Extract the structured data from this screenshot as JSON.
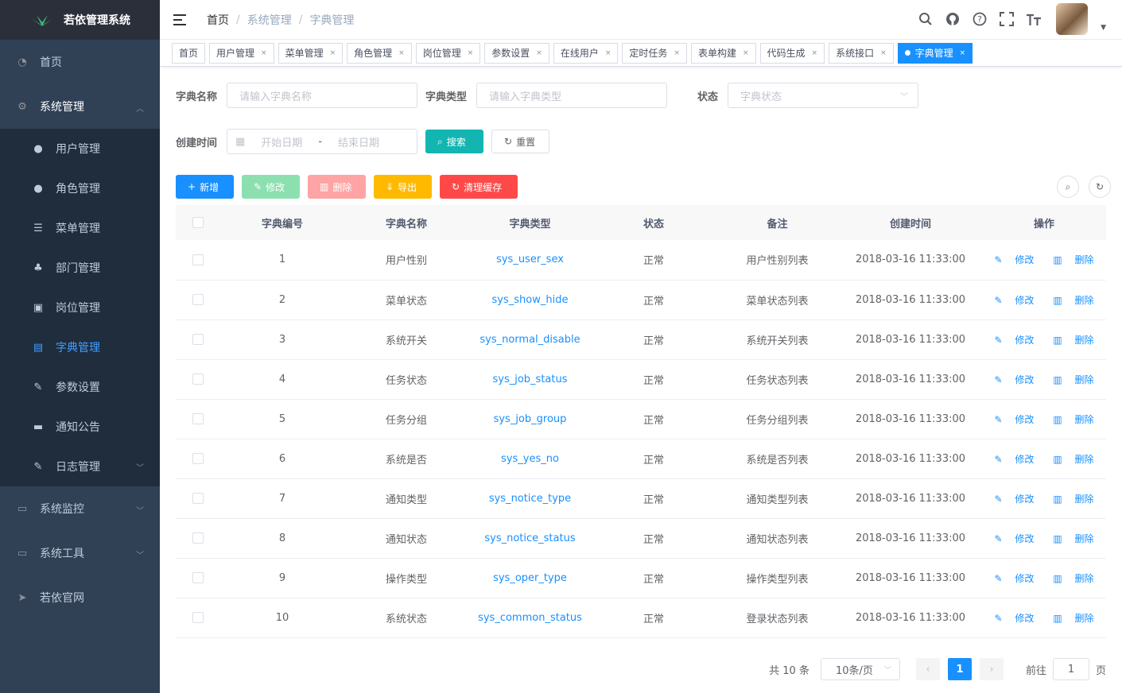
{
  "app": {
    "title": "若依管理系统"
  },
  "sidebar": {
    "home": "首页",
    "system": "系统管理",
    "sub": [
      "用户管理",
      "角色管理",
      "菜单管理",
      "部门管理",
      "岗位管理",
      "字典管理",
      "参数设置",
      "通知公告",
      "日志管理"
    ],
    "monitor": "系统监控",
    "tools": "系统工具",
    "site": "若依官网"
  },
  "breadcrumb": {
    "home": "首页",
    "sep": "/",
    "section": "系统管理",
    "page": "字典管理"
  },
  "tags": [
    "首页",
    "用户管理",
    "菜单管理",
    "角色管理",
    "岗位管理",
    "参数设置",
    "在线用户",
    "定时任务",
    "表单构建",
    "代码生成",
    "系统接口",
    "字典管理"
  ],
  "tag_close": "×",
  "search": {
    "name_label": "字典名称",
    "name_placeholder": "请输入字典名称",
    "type_label": "字典类型",
    "type_placeholder": "请输入字典类型",
    "status_label": "状态",
    "status_placeholder": "字典状态",
    "time_label": "创建时间",
    "start_placeholder": "开始日期",
    "range_sep": "-",
    "end_placeholder": "结束日期",
    "search_btn": "搜索",
    "reset_btn": "重置"
  },
  "toolbar": {
    "add": "新增",
    "edit": "修改",
    "delete": "删除",
    "export": "导出",
    "clear_cache": "清理缓存"
  },
  "table": {
    "headers": [
      "字典编号",
      "字典名称",
      "字典类型",
      "状态",
      "备注",
      "创建时间",
      "操作"
    ],
    "rows": [
      {
        "id": "1",
        "name": "用户性别",
        "type": "sys_user_sex",
        "status": "正常",
        "remark": "用户性别列表",
        "time": "2018-03-16 11:33:00"
      },
      {
        "id": "2",
        "name": "菜单状态",
        "type": "sys_show_hide",
        "status": "正常",
        "remark": "菜单状态列表",
        "time": "2018-03-16 11:33:00"
      },
      {
        "id": "3",
        "name": "系统开关",
        "type": "sys_normal_disable",
        "status": "正常",
        "remark": "系统开关列表",
        "time": "2018-03-16 11:33:00"
      },
      {
        "id": "4",
        "name": "任务状态",
        "type": "sys_job_status",
        "status": "正常",
        "remark": "任务状态列表",
        "time": "2018-03-16 11:33:00"
      },
      {
        "id": "5",
        "name": "任务分组",
        "type": "sys_job_group",
        "status": "正常",
        "remark": "任务分组列表",
        "time": "2018-03-16 11:33:00"
      },
      {
        "id": "6",
        "name": "系统是否",
        "type": "sys_yes_no",
        "status": "正常",
        "remark": "系统是否列表",
        "time": "2018-03-16 11:33:00"
      },
      {
        "id": "7",
        "name": "通知类型",
        "type": "sys_notice_type",
        "status": "正常",
        "remark": "通知类型列表",
        "time": "2018-03-16 11:33:00"
      },
      {
        "id": "8",
        "name": "通知状态",
        "type": "sys_notice_status",
        "status": "正常",
        "remark": "通知状态列表",
        "time": "2018-03-16 11:33:00"
      },
      {
        "id": "9",
        "name": "操作类型",
        "type": "sys_oper_type",
        "status": "正常",
        "remark": "操作类型列表",
        "time": "2018-03-16 11:33:00"
      },
      {
        "id": "10",
        "name": "系统状态",
        "type": "sys_common_status",
        "status": "正常",
        "remark": "登录状态列表",
        "time": "2018-03-16 11:33:00"
      }
    ],
    "row_edit": "修改",
    "row_delete": "删除"
  },
  "pagination": {
    "total": "共 10 条",
    "size": "10条/页",
    "current": "1",
    "goto": "前往",
    "goto_value": "1",
    "page_unit": "页"
  },
  "colors": {
    "sidebar": "#304156",
    "primary": "#1890ff",
    "success": "#13ce66",
    "danger": "#ff4949",
    "warning": "#ffba00",
    "cyan": "#13b5b1"
  }
}
